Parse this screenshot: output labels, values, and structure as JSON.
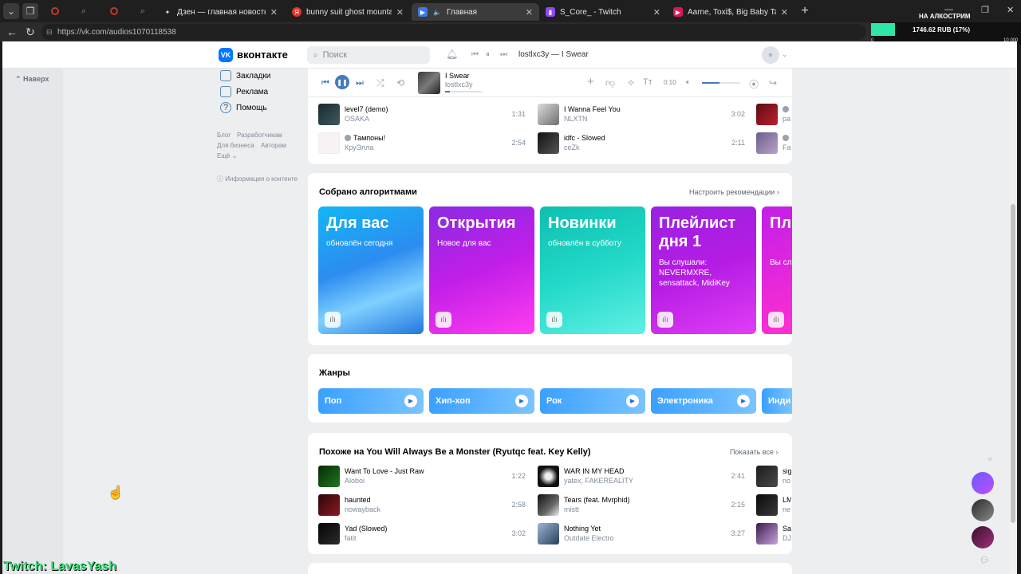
{
  "browser": {
    "tabs": [
      {
        "title": "Дзен — главная новостная информация",
        "active": false
      },
      {
        "title": "bunny suit ghost mountain — Яндекс",
        "active": false
      },
      {
        "title": "Главная",
        "active": true
      },
      {
        "title": "S_Core_ - Twitch",
        "active": false
      },
      {
        "title": "Aarne, Toxi$, Big Baby Tape - \"NOI",
        "active": false
      }
    ],
    "url": "https://vk.com/audios1070118538"
  },
  "stream_overlay": {
    "label": "НА АЛКОСТРИМ",
    "value": "1746.62 RUB (17%)",
    "progress": 0.17,
    "min": "0",
    "max": "10 000"
  },
  "vk": {
    "logo_text": "вконтакте",
    "search_placeholder": "Поиск",
    "now_playing": "lostlxc3y — I Swear"
  },
  "left_rail": {
    "back_to_top": "Наверх"
  },
  "left_nav": [
    {
      "label": "Закладки",
      "icon": "bookmark-icon"
    },
    {
      "label": "Реклама",
      "icon": "megaphone-icon"
    },
    {
      "label": "Помощь",
      "icon": "help-icon"
    }
  ],
  "left_footer": {
    "links_row1": [
      "Блог",
      "Разработчикам"
    ],
    "links_row2": [
      "Для бизнеса",
      "Авторам"
    ],
    "more": "Ещё",
    "info": "Информация о контенте"
  },
  "player": {
    "title": "I Swear",
    "artist": "lostlxc3y",
    "time": "0:10",
    "progress": 0.12,
    "volume": 0.45
  },
  "top_tracks": [
    {
      "title": "level7 (demo)",
      "artist": "OSAKA",
      "duration": "1:31",
      "explicit": false
    },
    {
      "title": "Тампоны!",
      "artist": "КруЭлла",
      "duration": "2:54",
      "explicit": true
    },
    {
      "title": "I Wanna Feel You",
      "artist": "NLXTN",
      "duration": "3:02",
      "explicit": false
    },
    {
      "title": "idfc - Slowed",
      "artist": "ceZk",
      "duration": "2:11",
      "explicit": false
    },
    {
      "title": "",
      "artist": "pa",
      "duration": "",
      "explicit": true
    },
    {
      "title": "",
      "artist": "Fal",
      "duration": "",
      "explicit": true
    }
  ],
  "algo_section": {
    "title": "Собрано алгоритмами",
    "link": "Настроить рекомендации",
    "tiles": [
      {
        "title": "Для вас",
        "sub": "обновлён сегодня"
      },
      {
        "title": "Открытия",
        "sub": "Новое для вас"
      },
      {
        "title": "Новинки",
        "sub": "обновлён в субботу"
      },
      {
        "title": "Плейлист дня 1",
        "sub": "Вы слушали: NEVERMXRE, sensattack, MidiKey"
      },
      {
        "title": "Пл дн",
        "sub": "Вы сл Pavlos"
      }
    ]
  },
  "genres_section": {
    "title": "Жанры",
    "items": [
      "Поп",
      "Хип-хоп",
      "Рок",
      "Электроника",
      "Инди"
    ]
  },
  "similar_section": {
    "title": "Похоже на You Will Always Be a Monster (Ryutqc feat. Key Kelly)",
    "link": "Показать все",
    "tracks": [
      {
        "title": "Want To Love - Just Raw",
        "artist": "Aloboi",
        "duration": "1:22"
      },
      {
        "title": "haunted",
        "artist": "nowayback",
        "duration": "2:58"
      },
      {
        "title": "Yad (Slowed)",
        "artist": "fatit",
        "duration": "3:02"
      },
      {
        "title": "WAR IN MY HEAD",
        "artist": "yatex, FAKEREALITY",
        "duration": "2:41"
      },
      {
        "title": "Tears (feat. Mvrphid)",
        "artist": "mistt",
        "duration": "2:15"
      },
      {
        "title": "Nothing Yet",
        "artist": "Outdate Electro",
        "duration": "3:27"
      },
      {
        "title": "sig",
        "artist": "no",
        "duration": ""
      },
      {
        "title": "LM",
        "artist": "ne",
        "duration": ""
      },
      {
        "title": "Sa",
        "artist": "DJ",
        "duration": ""
      }
    ]
  },
  "watermark": "Twitch: LavasYash",
  "colors": {
    "vk_blue": "#0077ff",
    "accent": "#447bba",
    "overlay_green": "#2ee6a8",
    "watermark_green": "#3de07a"
  }
}
